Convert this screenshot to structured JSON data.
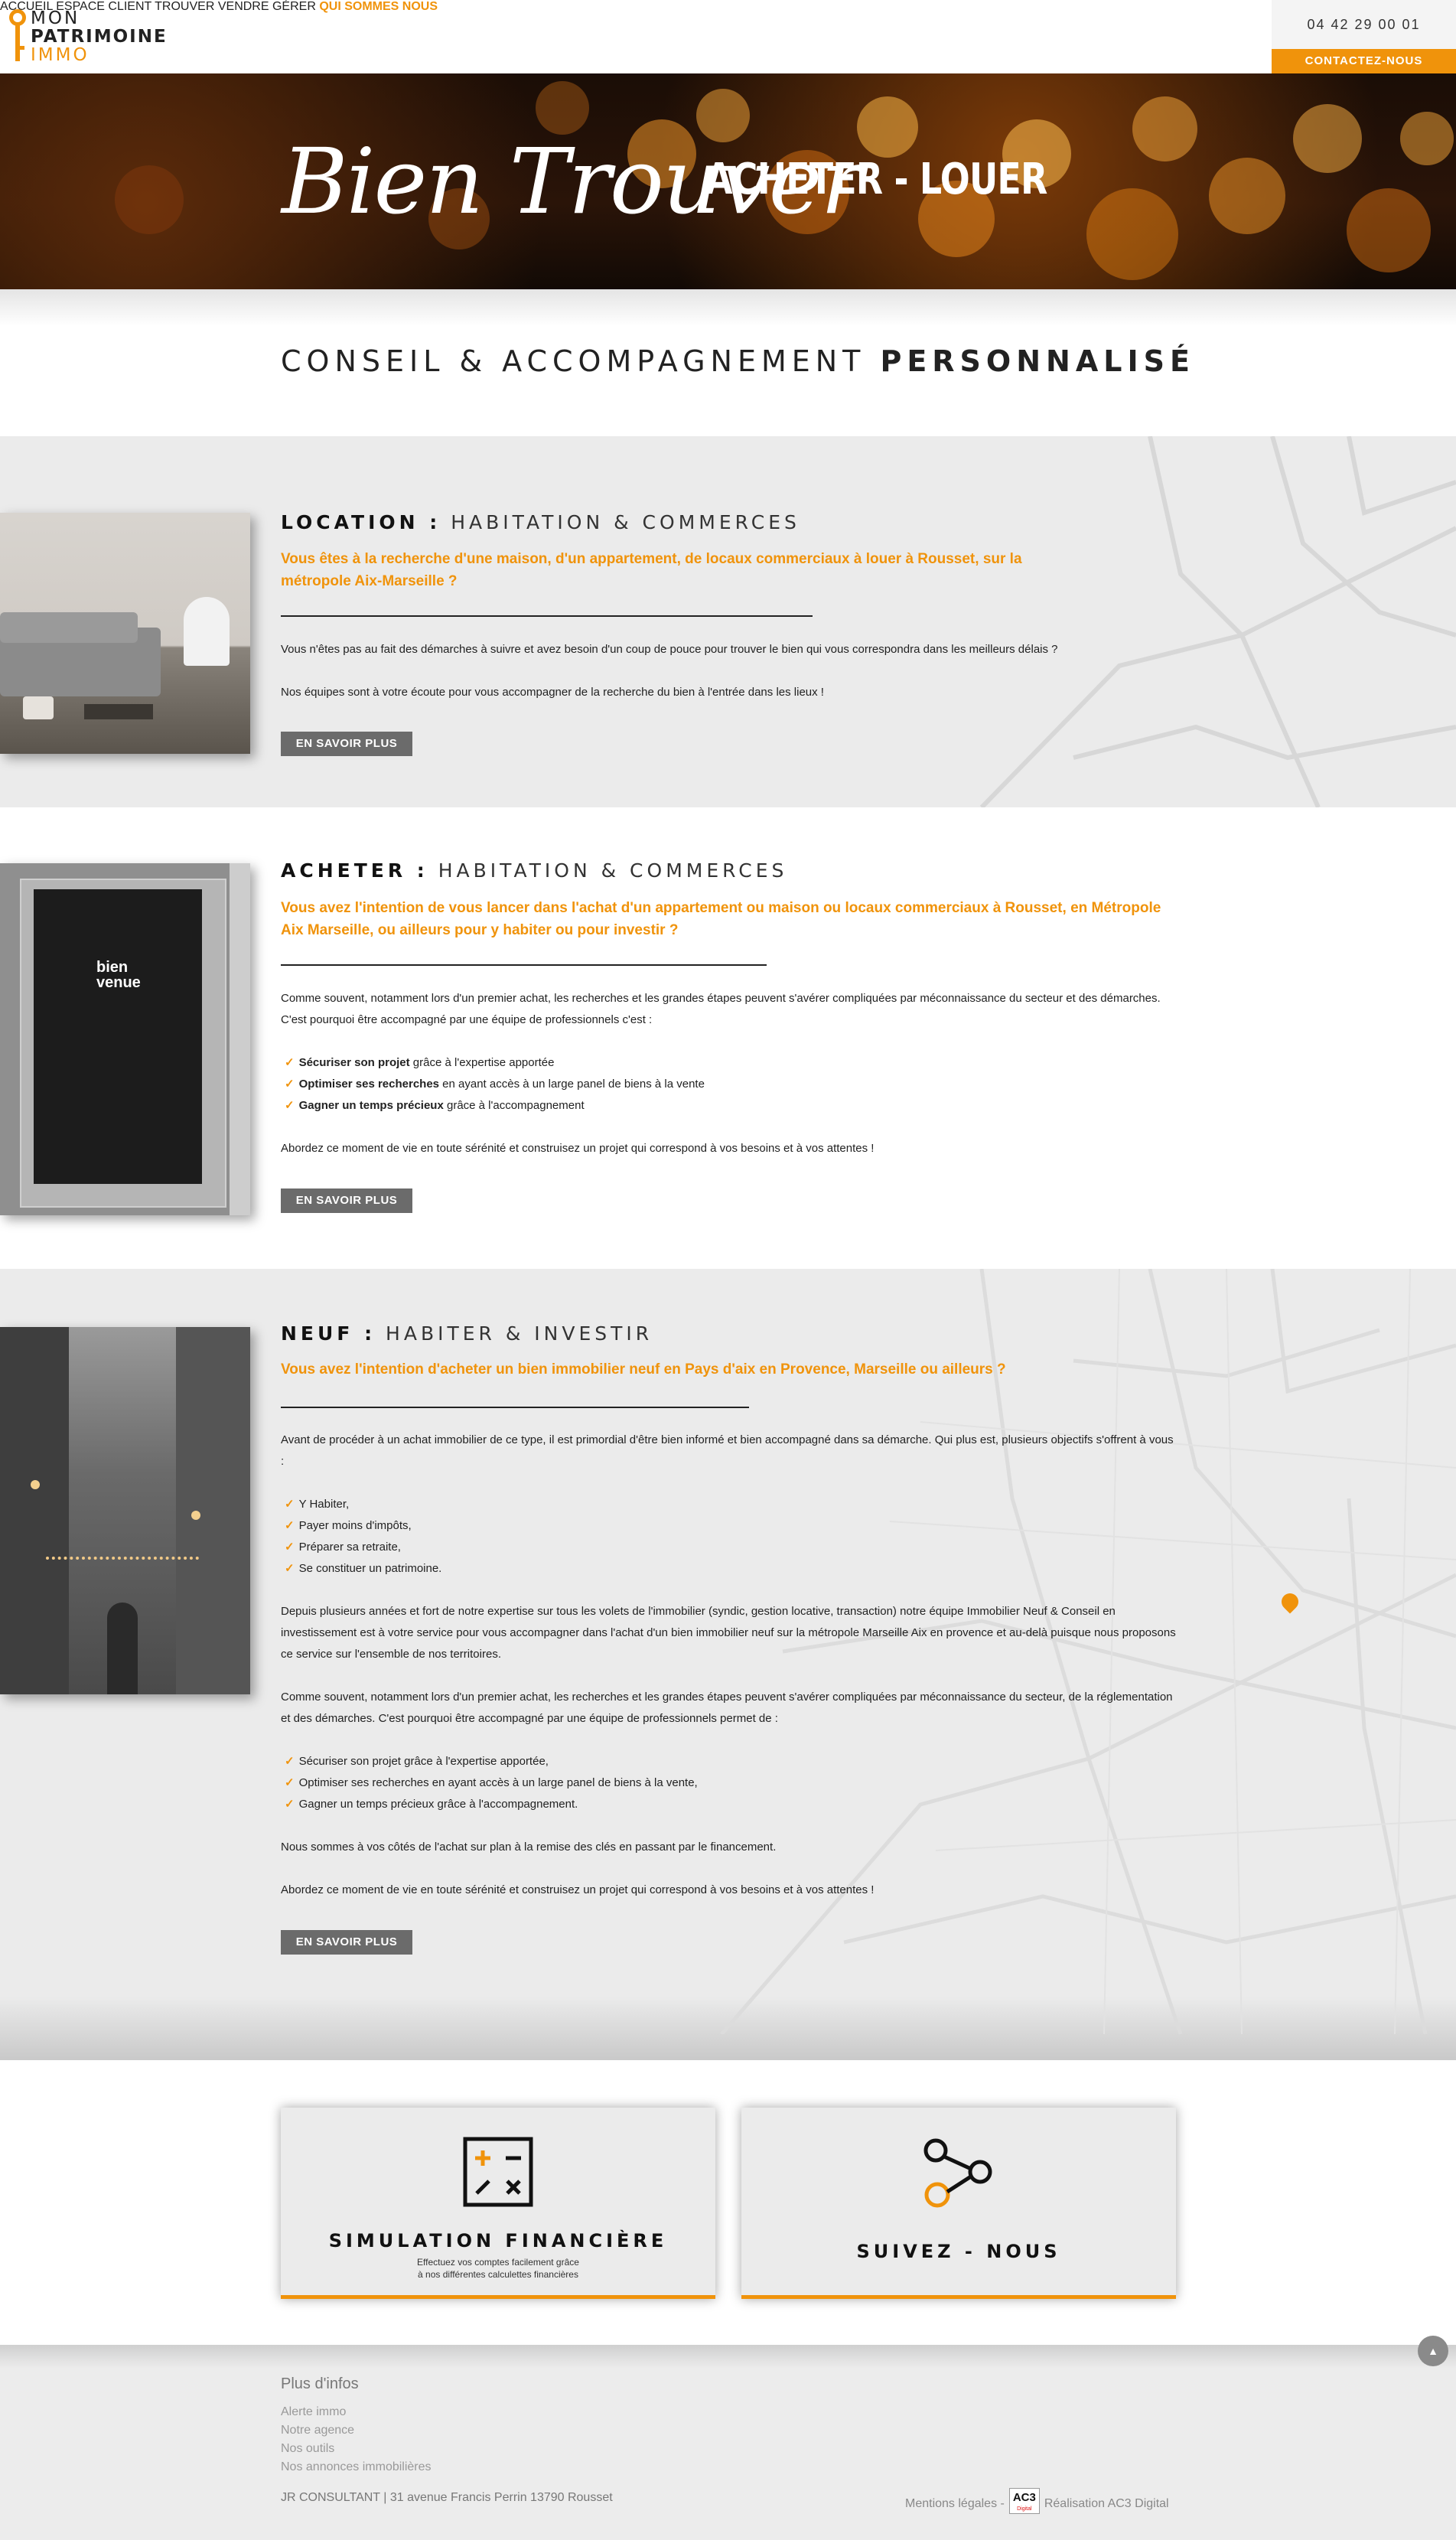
{
  "header": {
    "logo": {
      "line1": "MON",
      "line2": "PATRIMOINE",
      "line3": "IMMO"
    },
    "nav": [
      "ACCUEIL",
      "ESPACE CLIENT",
      "TROUVER",
      "VENDRE",
      "GÉRER",
      "QUI SOMMES NOUS"
    ],
    "phone": "04 42 29 00 01",
    "contact_label": "CONTACTEZ-NOUS"
  },
  "hero": {
    "script_title": "Bien Trouver",
    "caps_title": "ACHETER - LOUER"
  },
  "intro": {
    "title_regular": "CONSEIL & ACCOMPAGNEMENT",
    "title_bold": "PERSONNALISÉ"
  },
  "location": {
    "title_bold": "LOCATION :",
    "title_rest": "HABITATION & COMMERCES",
    "lead": "Vous êtes à la recherche d'une maison, d'un appartement, de locaux commerciaux à louer à Rousset, sur la métropole Aix-Marseille ?",
    "p1": "Vous n'êtes pas au fait des démarches à suivre et avez besoin d'un coup de pouce pour trouver le bien qui vous correspondra dans les meilleurs délais ?",
    "p2": "Nos équipes sont à votre écoute pour vous accompagner de la recherche du bien à l'entrée dans les lieux !",
    "button": "EN SAVOIR PLUS"
  },
  "acheter": {
    "title_bold": "ACHETER :",
    "title_rest": "HABITATION & COMMERCES",
    "lead": "Vous avez l'intention de vous lancer dans l'achat d'un appartement ou maison ou locaux commerciaux à Rousset, en Métropole Aix Marseille, ou ailleurs pour y habiter ou pour investir ?",
    "p1": "Comme souvent, notamment lors d'un premier achat, les recherches et les grandes étapes peuvent s'avérer compliquées par méconnaissance du secteur et des démarches. C'est pourquoi être accompagné par une équipe de professionnels c'est :",
    "items": [
      {
        "bold": "Sécuriser son projet",
        "rest": " grâce à l'expertise apportée"
      },
      {
        "bold": "Optimiser ses recherches",
        "rest": " en ayant accès à un large panel de biens à la vente"
      },
      {
        "bold": "Gagner un temps précieux",
        "rest": " grâce à l'accompagnement"
      }
    ],
    "p2": "Abordez ce moment de vie en toute sérénité et construisez un projet qui correspond à vos besoins et à vos attentes !",
    "photo_text": "bien venue",
    "button": "EN SAVOIR PLUS"
  },
  "neuf": {
    "title_bold": "NEUF :",
    "title_rest": "HABITER & INVESTIR",
    "lead": "Vous avez l'intention d'acheter un bien immobilier neuf en Pays d'aix en Provence, Marseille ou ailleurs ?",
    "p1": "Avant de procéder à un achat immobilier de ce type, il est primordial d'être bien informé et bien accompagné dans sa démarche. Qui plus est, plusieurs objectifs s'offrent à vous :",
    "items1": [
      "Y Habiter,",
      "Payer moins d'impôts,",
      "Préparer sa retraite,",
      "Se constituer un patrimoine."
    ],
    "p2": "Depuis plusieurs années et fort de notre expertise sur tous les volets de l'immobilier (syndic, gestion locative, transaction) notre équipe Immobilier Neuf & Conseil en investissement est à votre service pour vous accompagner dans l'achat d'un bien immobilier neuf sur la métropole Marseille Aix en provence et au-delà puisque nous proposons ce service sur l'ensemble de nos territoires.",
    "p3": "Comme souvent, notamment lors d'un premier achat, les recherches et les grandes étapes peuvent s'avérer compliquées par méconnaissance du secteur, de la réglementation et des démarches. C'est pourquoi être accompagné par une équipe de professionnels permet de :",
    "items2": [
      "Sécuriser son projet grâce à l'expertise apportée,",
      "Optimiser ses recherches en ayant accès à un large panel de biens à la vente,",
      "Gagner un temps précieux grâce à l'accompagnement."
    ],
    "p4": "Nous sommes à vos côtés de l'achat sur plan à la remise des clés en passant par le financement.",
    "p5": "Abordez ce moment de vie en toute sérénité et construisez un projet qui correspond à vos besoins et à vos attentes !",
    "button": "EN SAVOIR PLUS"
  },
  "cards": {
    "simulation": {
      "title": "SIMULATION FINANCIÈRE",
      "sub1": "Effectuez vos comptes facilement grâce",
      "sub2": "à nos différentes calculettes financières"
    },
    "suivez": {
      "title": "SUIVEZ - NOUS"
    }
  },
  "footer": {
    "heading": "Plus d'infos",
    "links": [
      "Alerte immo",
      "Notre agence",
      "Nos outils",
      "Nos annonces immobilières"
    ],
    "address": "JR CONSULTANT | 31 avenue Francis Perrin 13790 Rousset",
    "legal": "Mentions légales -",
    "ac3_logo": "AC3",
    "ac3_logo_sub": "Digital",
    "realisation": "Réalisation AC3 Digital"
  },
  "colors": {
    "accent": "#f0930b",
    "button_gray": "#6b6b6b",
    "section_gray": "#ebebeb"
  }
}
